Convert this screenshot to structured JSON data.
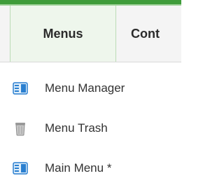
{
  "menubar": {
    "tabs": [
      {
        "label": "Menus"
      },
      {
        "label": "Cont"
      }
    ]
  },
  "dropdown": {
    "items": [
      {
        "label": "Menu Manager",
        "icon": "menu-manager-icon"
      },
      {
        "label": "Menu Trash",
        "icon": "trash-can-icon"
      },
      {
        "label": "Main Menu *",
        "icon": "menu-icon"
      }
    ]
  },
  "colors": {
    "accent_green": "#3f9c3a",
    "menubar_bg": "#f4f4f4",
    "active_tab_bg": "#eef6ec",
    "icon_blue": "#2a7fd0"
  }
}
